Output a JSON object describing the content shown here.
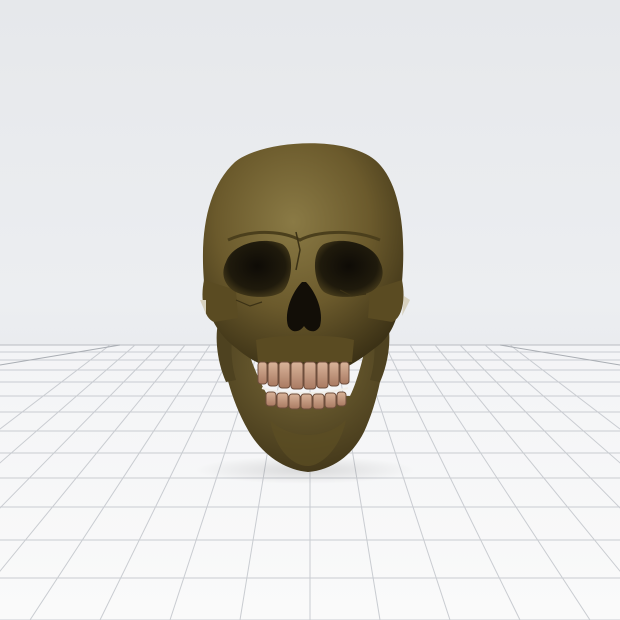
{
  "scene": {
    "object": "skull",
    "colors": {
      "background": "#e9ebee",
      "floor": "#f5f6f7",
      "grid_line": "#c9ccd1",
      "bone": "#6b5a2c",
      "bone_highlight": "#8a7a45",
      "bone_shadow": "#2e2612",
      "teeth": "#c99e84"
    }
  }
}
